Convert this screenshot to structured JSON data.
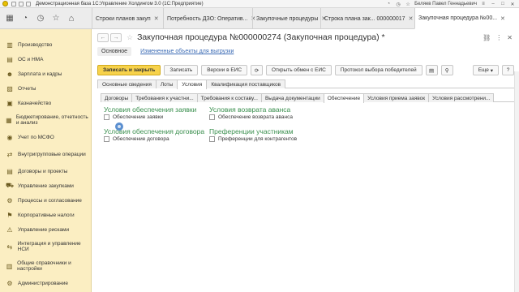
{
  "titlebar": {
    "title": "Демонстрационная база 1С:Управление Холдингом 3.0 (1С:Предприятие)",
    "user": "Беляев Павел Геннадьевич"
  },
  "top_tabs": [
    {
      "label": "Строки планов закуп",
      "active": false
    },
    {
      "label": "Потребность ДЗО: Оператив...",
      "active": false
    },
    {
      "label": "Закупочные процедуры",
      "active": false
    },
    {
      "label": "Строка плана зак... 000000017",
      "active": false
    },
    {
      "label": "Закупочная процедура №00...",
      "active": true
    }
  ],
  "sidebar": {
    "items": [
      {
        "label": "Производство",
        "icon": "factory-icon"
      },
      {
        "label": "ОС и НМА",
        "icon": "assets-icon"
      },
      {
        "label": "Зарплата и кадры",
        "icon": "people-icon"
      },
      {
        "label": "Отчеты",
        "icon": "report-icon"
      },
      {
        "label": "Казначейство",
        "icon": "treasury-icon"
      },
      {
        "label": "Бюджетирование, отчетность и анализ",
        "icon": "budget-icon"
      },
      {
        "label": "Учет по МСФО",
        "icon": "ifrs-icon"
      },
      {
        "label": "Внутригрупповые операции",
        "icon": "group-ops-icon"
      },
      {
        "label": "Договоры и проекты",
        "icon": "contracts-icon"
      },
      {
        "label": "Управление закупками",
        "icon": "purchases-icon"
      },
      {
        "label": "Процессы и согласование",
        "icon": "process-icon"
      },
      {
        "label": "Корпоративные налоги",
        "icon": "tax-icon"
      },
      {
        "label": "Управление рисками",
        "icon": "risk-icon"
      },
      {
        "label": "Интеграция и управление НСИ",
        "icon": "integration-icon"
      },
      {
        "label": "Общие справочники и настройки",
        "icon": "settings-icon"
      },
      {
        "label": "Администрирование",
        "icon": "admin-icon"
      }
    ]
  },
  "document": {
    "title": "Закупочная процедура №000000274 (Закупочная процедура) *",
    "nav_main": "Основное",
    "nav_link": "Измененные объекты для выгрузки"
  },
  "toolbar": {
    "save_close": "Записать и закрыть",
    "save": "Записать",
    "versions": "Версии в ЕИС",
    "check_exchange": "Открыть обмен с ЕИС",
    "protocol": "Протокол выбора победителей",
    "more": "Еще",
    "help": "?"
  },
  "main_tabs": [
    {
      "label": "Основные сведения",
      "active": false
    },
    {
      "label": "Лоты",
      "active": false
    },
    {
      "label": "Условия",
      "active": true
    },
    {
      "label": "Квалификация поставщиков",
      "active": false
    }
  ],
  "sub_tabs": [
    {
      "label": "Договоры",
      "active": false
    },
    {
      "label": "Требования к участни...",
      "active": false
    },
    {
      "label": "Требования к составу...",
      "active": false
    },
    {
      "label": "Выдача документации",
      "active": false
    },
    {
      "label": "Обеспечение",
      "active": true
    },
    {
      "label": "Условия приема заявок",
      "active": false
    },
    {
      "label": "Условия рассмотрени...",
      "active": false
    }
  ],
  "sections": {
    "bid_security": {
      "title": "Условия обеспечения заявки",
      "checkbox": "Обеспечение заявки",
      "checked": false
    },
    "advance_return": {
      "title": "Условия возврата аванса",
      "checkbox": "Обеспечение возврата аванса",
      "checked": false
    },
    "contract_security": {
      "title": "Условия обеспечения договора",
      "checkbox": "Обеспечение договора",
      "checked": false
    },
    "preferences": {
      "title": "Преференции участникам",
      "checkbox": "Преференции для контрагентов",
      "checked": false
    }
  },
  "colors": {
    "sidebar_bg": "#fbeec2",
    "primary_button": "#f7d24b",
    "section_title": "#3a8f4e",
    "link": "#3b6bb5"
  }
}
